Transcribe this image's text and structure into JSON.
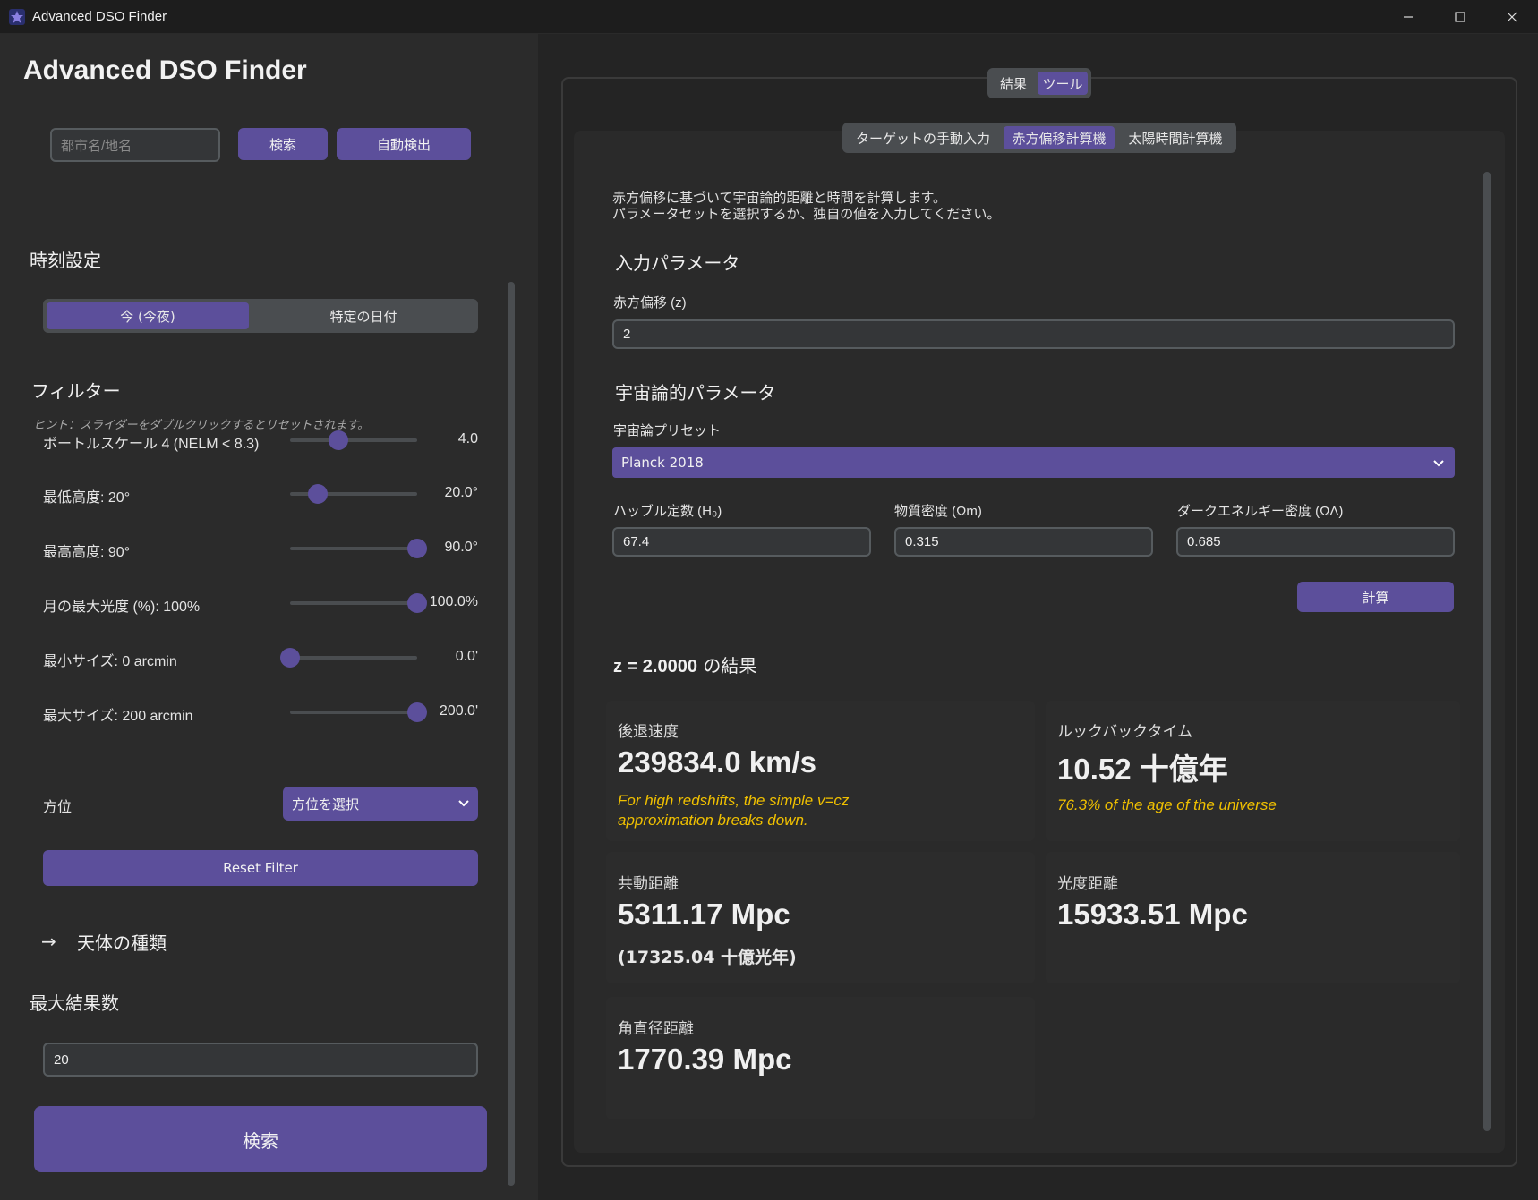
{
  "window": {
    "title": "Advanced DSO Finder"
  },
  "sidebar": {
    "heading": "Advanced DSO Finder",
    "location_placeholder": "都市名/地名",
    "search_btn": "検索",
    "auto_detect_btn": "自動検出",
    "time_heading": "時刻設定",
    "time_options": [
      "今 (今夜)",
      "特定の日付"
    ],
    "filter_heading": "フィルター",
    "hint": "ヒント：スライダーをダブルクリックするとリセットされます。",
    "sliders": [
      {
        "label": "ボートルスケール 4 (NELM < 8.3)",
        "value": "4.0",
        "fraction": 0.38
      },
      {
        "label": "最低高度: 20°",
        "value": "20.0°",
        "fraction": 0.22
      },
      {
        "label": "最高高度: 90°",
        "value": "90.0°",
        "fraction": 1.0
      },
      {
        "label": "月の最大光度 (%): 100%",
        "value": "100.0%",
        "fraction": 1.0
      },
      {
        "label": "最小サイズ: 0 arcmin",
        "value": "0.0'",
        "fraction": 0.0
      },
      {
        "label": "最大サイズ: 200 arcmin",
        "value": "200.0'",
        "fraction": 1.0
      }
    ],
    "direction_label": "方位",
    "direction_select": "方位を選択",
    "reset_filter": "Reset Filter",
    "object_types_arrow": "→",
    "object_types": "天体の種類",
    "max_results_heading": "最大結果数",
    "max_results_value": "20",
    "main_search": "検索"
  },
  "main": {
    "outer_tabs": [
      "結果",
      "ツール"
    ],
    "inner_tabs": [
      "ターゲットの手動入力",
      "赤方偏移計算機",
      "太陽時間計算機"
    ],
    "description": [
      "赤方偏移に基づいて宇宙論的距離と時間を計算します。",
      "パラメータセットを選択するか、独自の値を入力してください。"
    ],
    "input_heading": "入力パラメータ",
    "redshift_label": "赤方偏移 (z)",
    "redshift_value": "2",
    "cosmo_heading": "宇宙論的パラメータ",
    "preset_label": "宇宙論プリセット",
    "preset_value": "Planck 2018",
    "h0_label": "ハッブル定数 (H₀)",
    "h0_value": "67.4",
    "om_label": "物質密度 (Ωm)",
    "om_value": "0.315",
    "ol_label": "ダークエネルギー密度 (ΩΛ)",
    "ol_value": "0.685",
    "calc_btn": "計算",
    "results_z": "z = 2.0000",
    "results_suffix": "の結果",
    "cards": {
      "recession": {
        "title": "後退速度",
        "value": "239834.0 km/s",
        "note1": "For high redshifts, the simple v=cz",
        "note2": "approximation breaks down."
      },
      "lookback": {
        "title": "ルックバックタイム",
        "value": "10.52 十億年",
        "note": "76.3% of the age of the universe"
      },
      "comoving": {
        "title": "共動距離",
        "value": "5311.17 Mpc",
        "sub": "(17325.04 十億光年)"
      },
      "luminosity": {
        "title": "光度距離",
        "value": "15933.51 Mpc"
      },
      "angular": {
        "title": "角直径距離",
        "value": "1770.39 Mpc"
      }
    }
  },
  "colors": {
    "accent": "#5c4f9b",
    "warning": "#f0c000"
  }
}
